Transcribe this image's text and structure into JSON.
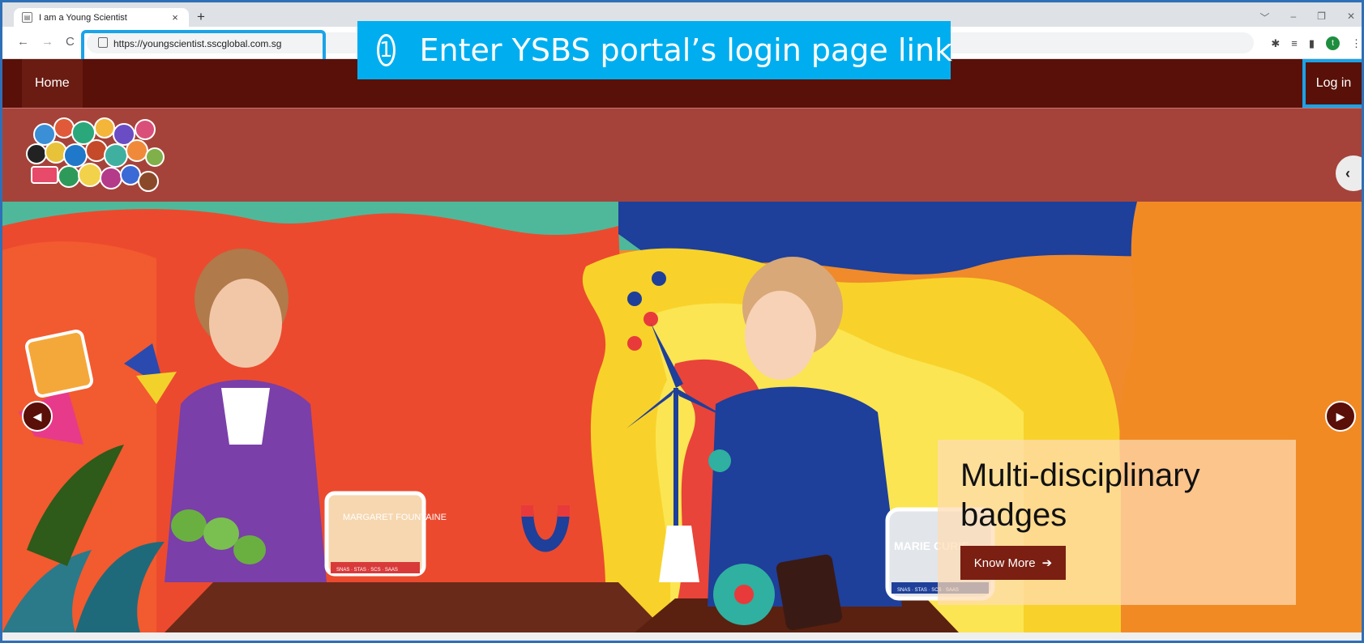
{
  "browser": {
    "tab_title": "I am a Young Scientist",
    "tab_close": "×",
    "new_tab": "+",
    "url": "https://youngscientist.sscglobal.com.sg",
    "back": "←",
    "forward": "→",
    "reload": "C",
    "profile_initial": "t",
    "window_controls": [
      "﹀",
      "–",
      "❐",
      "✕"
    ],
    "icons": [
      "puzzle-icon",
      "reading-list-icon",
      "side-panel-icon",
      "profile-icon",
      "menu-icon"
    ]
  },
  "callout": {
    "number": "①",
    "text": "Enter YSBS portal’s login page link",
    "color": "#00aeef"
  },
  "site": {
    "nav_home": "Home",
    "nav_login": "Log in",
    "colors": {
      "nav": "#581008",
      "brand": "#a5433a",
      "button": "#7a1f12"
    }
  },
  "hero": {
    "caption_title": "Multi-disciplinary badges",
    "button_label": "Know More",
    "badge_left_text": "MARGARET FOUNTAINE",
    "badge_left_sub": "SNAS · STAS · SCS · SAAS",
    "badge_right_text": "MARIE CURIE",
    "badge_right_sub": "SNAS · STAS · SCS · SAAS"
  }
}
